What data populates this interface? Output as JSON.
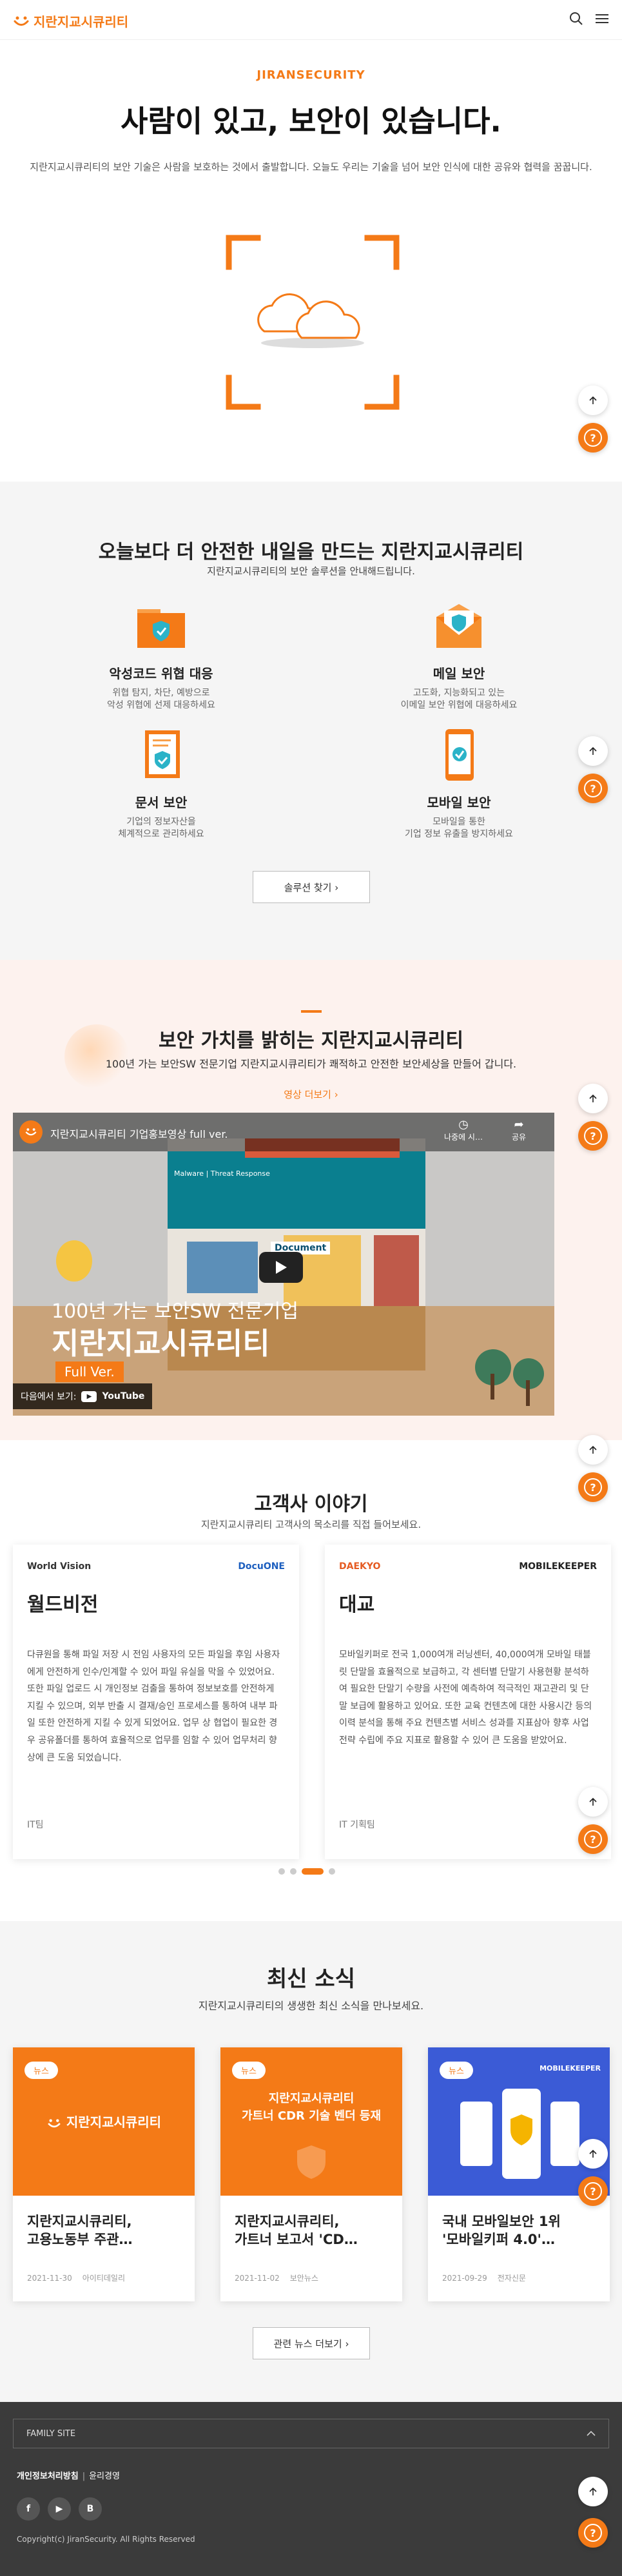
{
  "header": {
    "logo_text": "지란지교시큐리티",
    "search_icon": "search-icon",
    "menu_icon": "hamburger-menu-icon"
  },
  "hero": {
    "eyebrow": "JIRANSECURITY",
    "title": "사람이 있고, 보안이 있습니다.",
    "description": "지란지교시큐리티의 보안 기술은 사람을 보호하는 것에서 출발합니다. 오늘도 우리는 기술을 넘어 보안 인식에 대한 공유와 협력을 꿈꿉니다."
  },
  "solutions": {
    "title": "오늘보다 더 안전한 내일을 만드는 지란지교시큐리티",
    "subtitle": "지란지교시큐리티의 보안 솔루션을 안내해드립니다.",
    "items": [
      {
        "title": "악성코드 위협 대응",
        "desc1": "위협 탐지, 차단, 예방으로",
        "desc2": "악성 위협에 선제 대응하세요",
        "icon": "folder-shield-icon"
      },
      {
        "title": "메일 보안",
        "desc1": "고도화, 지능화되고 있는",
        "desc2": "이메일 보안 위협에 대응하세요",
        "icon": "envelope-shield-icon"
      },
      {
        "title": "문서 보안",
        "desc1": "기업의 정보자산을",
        "desc2": "체계적으로 관리하세요",
        "icon": "document-shield-icon"
      },
      {
        "title": "모바일 보안",
        "desc1": "모바일을 통한",
        "desc2": "기업 정보 유출을 방지하세요",
        "icon": "mobile-check-icon"
      }
    ],
    "button": "솔루션 찾기 ›"
  },
  "about": {
    "title": "보안 가치를 밝히는 지란지교시큐리티",
    "subtitle": "100년 가는 보안SW 전문기업 지란지교시큐리티가 쾌적하고 안전한 보안세상을 만들어 갑니다.",
    "more": "영상 더보기 ›",
    "video": {
      "title": "지란지교시큐리티 기업홍보영상 full ver.",
      "watch_later": "나중에 시…",
      "share": "공유",
      "tagline": "100년 가는 보안SW 전문기업",
      "brand": "지란지교시큐리티",
      "version": "Full Ver.",
      "watch_on": "다음에서 보기:",
      "youtube": "YouTube",
      "sign1": "Malware | Threat Response",
      "sign2": "Document"
    }
  },
  "customers": {
    "title": "고객사 이야기",
    "subtitle": "지란지교시큐리티 고객사의 목소리를 직접 들어보세요.",
    "cards": [
      {
        "client_logo": "World Vision",
        "product_logo": "DocuONE",
        "name": "월드비전",
        "body": "다큐원을 통해 파일 저장 시 전임 사용자의 모든 파일을 후임 사용자에게 안전하게 인수/인계할 수 있어 파일 유실을 막을 수 있었어요. 또한 파일 업로드 시 개인정보 검출을 통하여 정보보호를 안전하게 지킬 수 있으며, 외부 반출 시 결재/승인 프로세스를 통하여 내부 파일 또한 안전하게 지킬 수 있게 되었어요. 업무 상 협업이 필요한 경우 공유폴더를 통하여 효율적으로 업무를 임할 수 있어 업무처리 향상에 큰 도움 되었습니다.",
        "tag": "IT팀"
      },
      {
        "client_logo": "DAEKYO",
        "product_logo": "MOBILEKEEPER",
        "name": "대교",
        "body": "모바일키퍼로 전국 1,000여개 러닝센터, 40,000여개 모바일 태블릿 단말을 효율적으로 보급하고, 각 센터별 단말기 사용현황 분석하여 필요한 단말기 수량을 사전에 예측하여 적극적인 재고관리 및 단말 보급에 활용하고 있어요. 또한 교육 컨텐츠에 대한 사용시간 등의 이력 분석을 통해 주요 컨텐츠별 서비스 성과를 지표삼아 향후 사업전략 수립에 주요 지표로 활용할 수 있어 큰 도움을 받았어요.",
        "tag": "IT 기획팀"
      }
    ]
  },
  "news": {
    "title": "최신 소식",
    "subtitle": "지란지교시큐리티의 생생한 최신 소식을 만나보세요.",
    "badge": "뉴스",
    "items": [
      {
        "thumb_text": "지란지교시큐리티",
        "title_l1": "지란지교시큐리티,",
        "title_l2": "고용노동부 주관…",
        "date": "2021-11-30",
        "source": "아이티데일리"
      },
      {
        "thumb_text_1": "지란지교시큐리티",
        "thumb_text_2": "가트너 CDR 기술 벤더 등재",
        "title_l1": "지란지교시큐리티,",
        "title_l2": "가트너 보고서 'CD…",
        "date": "2021-11-02",
        "source": "보안뉴스"
      },
      {
        "thumb_text": "MOBILEKEEPER",
        "title_l1": "국내 모바일보안 1위",
        "title_l2": "'모바일키퍼 4.0'…",
        "date": "2021-09-29",
        "source": "전자신문"
      }
    ],
    "button": "관련 뉴스 더보기 ›"
  },
  "footer": {
    "family_site": "FAMILY SITE",
    "privacy": "개인정보처리방침",
    "email_policy": "윤리경영",
    "social": [
      "f",
      "▶",
      "B"
    ],
    "copyright": "Copyright(c) JiranSecurity. All Rights Reserved"
  },
  "colors": {
    "accent": "#f47a17",
    "footer_bg": "#3b3b3b",
    "section_gray": "#f5f5f5",
    "section_peach": "#fdf2ee"
  }
}
